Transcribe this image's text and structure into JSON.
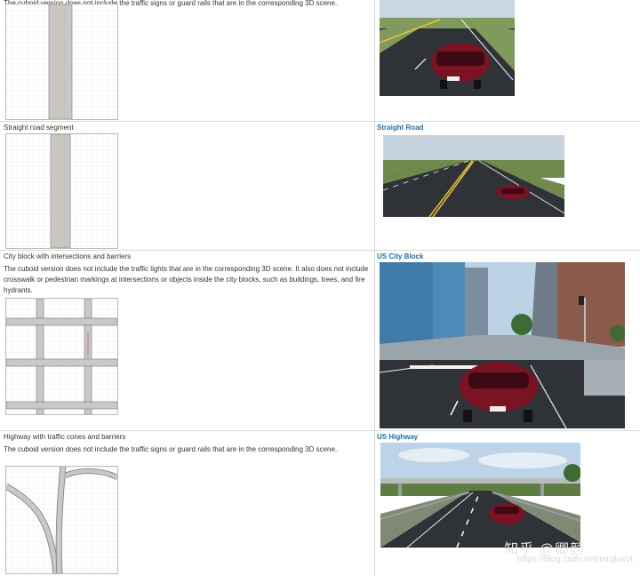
{
  "rows": [
    {
      "caption": "The cuboid version does not include the traffic signs or guard rails that are in the corresponding 3D scene.",
      "title": ""
    },
    {
      "caption": "Straight road segment",
      "title": "Straight Road"
    },
    {
      "caption": "City block with intersections and barriers",
      "description": "The cuboid version does not include the traffic lights that are in the corresponding 3D scene. It also does not include crosswalk or pedestrian markings at intersections or objects inside the city blocks, such as buildings, trees, and fire hydrants.",
      "title": "US City Block"
    },
    {
      "caption": "Highway with traffic cones and barriers",
      "description": "The cuboid version does not include the traffic signs or guard rails that are in the corresponding 3D scene.",
      "title": "US Highway"
    }
  ],
  "watermark": {
    "brand": "知乎 @卿颜",
    "url": "https://blog.csdn.net/mrqlxevt"
  }
}
